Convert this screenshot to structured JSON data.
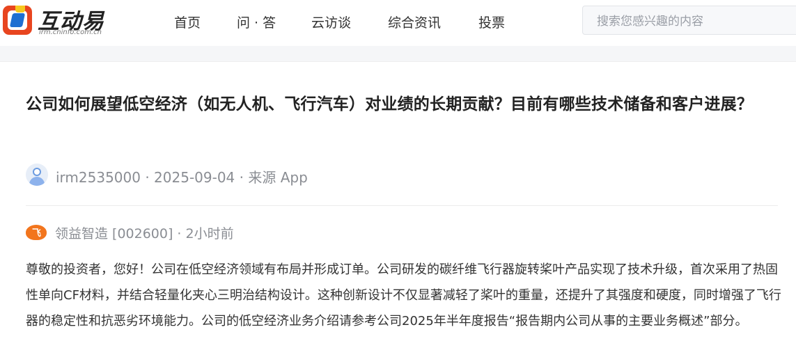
{
  "brand": {
    "name": "互动易",
    "url": "irm.cninfo.com.cn"
  },
  "nav": {
    "items": [
      {
        "label": "首页"
      },
      {
        "label": "问 · 答"
      },
      {
        "label": "云访谈"
      },
      {
        "label": "综合资讯"
      },
      {
        "label": "投票"
      }
    ]
  },
  "search": {
    "placeholder": "搜索您感兴趣的内容"
  },
  "question": {
    "title": "公司如何展望低空经济（如无人机、飞行汽车）对业绩的长期贡献？目前有哪些技术储备和客户进展？",
    "asker": "irm2535000",
    "date": "2025-09-04",
    "source": "来源 App",
    "meta_line": "irm2535000 · 2025-09-04 · 来源 App"
  },
  "answer": {
    "company": "领益智造",
    "code": "[002600]",
    "time": "2小时前",
    "header_line": "领益智造 [002600] · 2小时前",
    "logo_glyph": "飞",
    "body": "尊敬的投资者，您好！公司在低空经济领域有布局并形成订单。公司研发的碳纤维飞行器旋转桨叶产品实现了技术升级，首次采用了热固性单向CF材料，并结合轻量化夹心三明治结构设计。这种创新设计不仅显著减轻了桨叶的重量，还提升了其强度和硬度，同时增强了飞行器的稳定性和抗恶劣环境能力。公司的低空经济业务介绍请参考公司2025年半年度报告“报告期内公司从事的主要业务概述”部分。"
  },
  "colors": {
    "logo_red": "#e8451f",
    "logo_blue": "#1f6fd1",
    "logo_yellow": "#f7c81e",
    "company_orange": "#f2751d",
    "meta_gray": "#8a8d93"
  }
}
